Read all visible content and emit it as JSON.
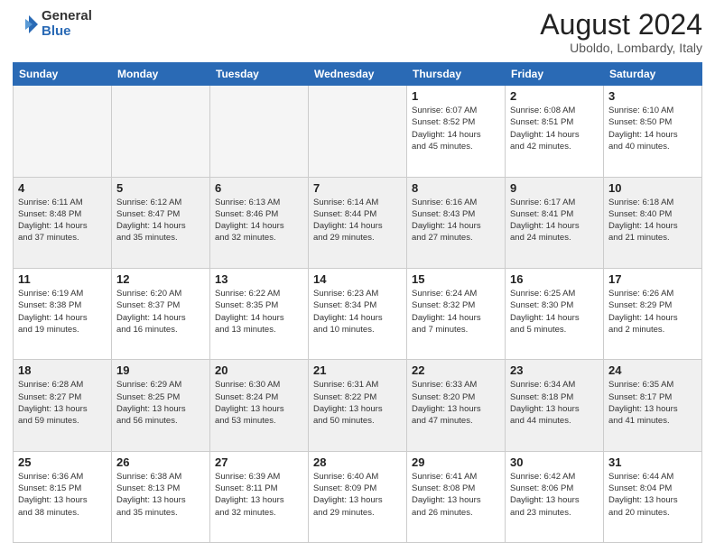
{
  "header": {
    "logo_general": "General",
    "logo_blue": "Blue",
    "month_year": "August 2024",
    "location": "Uboldo, Lombardy, Italy"
  },
  "days_of_week": [
    "Sunday",
    "Monday",
    "Tuesday",
    "Wednesday",
    "Thursday",
    "Friday",
    "Saturday"
  ],
  "weeks": [
    {
      "alt": false,
      "days": [
        {
          "num": "",
          "info": "",
          "empty": true
        },
        {
          "num": "",
          "info": "",
          "empty": true
        },
        {
          "num": "",
          "info": "",
          "empty": true
        },
        {
          "num": "",
          "info": "",
          "empty": true
        },
        {
          "num": "1",
          "info": "Sunrise: 6:07 AM\nSunset: 8:52 PM\nDaylight: 14 hours\nand 45 minutes.",
          "empty": false
        },
        {
          "num": "2",
          "info": "Sunrise: 6:08 AM\nSunset: 8:51 PM\nDaylight: 14 hours\nand 42 minutes.",
          "empty": false
        },
        {
          "num": "3",
          "info": "Sunrise: 6:10 AM\nSunset: 8:50 PM\nDaylight: 14 hours\nand 40 minutes.",
          "empty": false
        }
      ]
    },
    {
      "alt": true,
      "days": [
        {
          "num": "4",
          "info": "Sunrise: 6:11 AM\nSunset: 8:48 PM\nDaylight: 14 hours\nand 37 minutes.",
          "empty": false
        },
        {
          "num": "5",
          "info": "Sunrise: 6:12 AM\nSunset: 8:47 PM\nDaylight: 14 hours\nand 35 minutes.",
          "empty": false
        },
        {
          "num": "6",
          "info": "Sunrise: 6:13 AM\nSunset: 8:46 PM\nDaylight: 14 hours\nand 32 minutes.",
          "empty": false
        },
        {
          "num": "7",
          "info": "Sunrise: 6:14 AM\nSunset: 8:44 PM\nDaylight: 14 hours\nand 29 minutes.",
          "empty": false
        },
        {
          "num": "8",
          "info": "Sunrise: 6:16 AM\nSunset: 8:43 PM\nDaylight: 14 hours\nand 27 minutes.",
          "empty": false
        },
        {
          "num": "9",
          "info": "Sunrise: 6:17 AM\nSunset: 8:41 PM\nDaylight: 14 hours\nand 24 minutes.",
          "empty": false
        },
        {
          "num": "10",
          "info": "Sunrise: 6:18 AM\nSunset: 8:40 PM\nDaylight: 14 hours\nand 21 minutes.",
          "empty": false
        }
      ]
    },
    {
      "alt": false,
      "days": [
        {
          "num": "11",
          "info": "Sunrise: 6:19 AM\nSunset: 8:38 PM\nDaylight: 14 hours\nand 19 minutes.",
          "empty": false
        },
        {
          "num": "12",
          "info": "Sunrise: 6:20 AM\nSunset: 8:37 PM\nDaylight: 14 hours\nand 16 minutes.",
          "empty": false
        },
        {
          "num": "13",
          "info": "Sunrise: 6:22 AM\nSunset: 8:35 PM\nDaylight: 14 hours\nand 13 minutes.",
          "empty": false
        },
        {
          "num": "14",
          "info": "Sunrise: 6:23 AM\nSunset: 8:34 PM\nDaylight: 14 hours\nand 10 minutes.",
          "empty": false
        },
        {
          "num": "15",
          "info": "Sunrise: 6:24 AM\nSunset: 8:32 PM\nDaylight: 14 hours\nand 7 minutes.",
          "empty": false
        },
        {
          "num": "16",
          "info": "Sunrise: 6:25 AM\nSunset: 8:30 PM\nDaylight: 14 hours\nand 5 minutes.",
          "empty": false
        },
        {
          "num": "17",
          "info": "Sunrise: 6:26 AM\nSunset: 8:29 PM\nDaylight: 14 hours\nand 2 minutes.",
          "empty": false
        }
      ]
    },
    {
      "alt": true,
      "days": [
        {
          "num": "18",
          "info": "Sunrise: 6:28 AM\nSunset: 8:27 PM\nDaylight: 13 hours\nand 59 minutes.",
          "empty": false
        },
        {
          "num": "19",
          "info": "Sunrise: 6:29 AM\nSunset: 8:25 PM\nDaylight: 13 hours\nand 56 minutes.",
          "empty": false
        },
        {
          "num": "20",
          "info": "Sunrise: 6:30 AM\nSunset: 8:24 PM\nDaylight: 13 hours\nand 53 minutes.",
          "empty": false
        },
        {
          "num": "21",
          "info": "Sunrise: 6:31 AM\nSunset: 8:22 PM\nDaylight: 13 hours\nand 50 minutes.",
          "empty": false
        },
        {
          "num": "22",
          "info": "Sunrise: 6:33 AM\nSunset: 8:20 PM\nDaylight: 13 hours\nand 47 minutes.",
          "empty": false
        },
        {
          "num": "23",
          "info": "Sunrise: 6:34 AM\nSunset: 8:18 PM\nDaylight: 13 hours\nand 44 minutes.",
          "empty": false
        },
        {
          "num": "24",
          "info": "Sunrise: 6:35 AM\nSunset: 8:17 PM\nDaylight: 13 hours\nand 41 minutes.",
          "empty": false
        }
      ]
    },
    {
      "alt": false,
      "days": [
        {
          "num": "25",
          "info": "Sunrise: 6:36 AM\nSunset: 8:15 PM\nDaylight: 13 hours\nand 38 minutes.",
          "empty": false
        },
        {
          "num": "26",
          "info": "Sunrise: 6:38 AM\nSunset: 8:13 PM\nDaylight: 13 hours\nand 35 minutes.",
          "empty": false
        },
        {
          "num": "27",
          "info": "Sunrise: 6:39 AM\nSunset: 8:11 PM\nDaylight: 13 hours\nand 32 minutes.",
          "empty": false
        },
        {
          "num": "28",
          "info": "Sunrise: 6:40 AM\nSunset: 8:09 PM\nDaylight: 13 hours\nand 29 minutes.",
          "empty": false
        },
        {
          "num": "29",
          "info": "Sunrise: 6:41 AM\nSunset: 8:08 PM\nDaylight: 13 hours\nand 26 minutes.",
          "empty": false
        },
        {
          "num": "30",
          "info": "Sunrise: 6:42 AM\nSunset: 8:06 PM\nDaylight: 13 hours\nand 23 minutes.",
          "empty": false
        },
        {
          "num": "31",
          "info": "Sunrise: 6:44 AM\nSunset: 8:04 PM\nDaylight: 13 hours\nand 20 minutes.",
          "empty": false
        }
      ]
    }
  ]
}
